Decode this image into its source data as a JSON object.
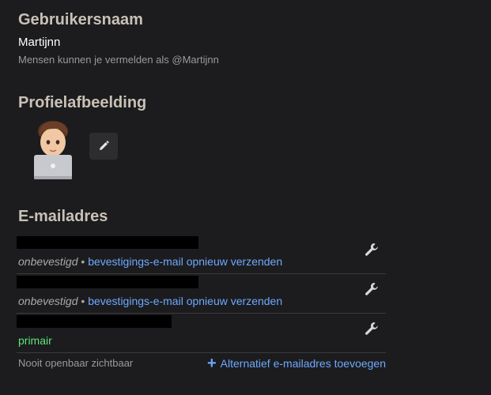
{
  "username_section": {
    "title": "Gebruikersnaam",
    "value": "Martijnn",
    "hint": "Mensen kunnen je vermelden als @Martijnn"
  },
  "avatar_section": {
    "title": "Profielafbeelding",
    "edit_icon": "pencil-icon"
  },
  "email_section": {
    "title": "E-mailadres",
    "rows": [
      {
        "status": "onbevestigd",
        "separator": "•",
        "action": "bevestigings-e-mail opnieuw verzenden"
      },
      {
        "status": "onbevestigd",
        "separator": "•",
        "action": "bevestigings-e-mail opnieuw verzenden"
      },
      {
        "status": "primair"
      }
    ],
    "footer_note": "Nooit openbaar zichtbaar",
    "add_label": "Alternatief e-mailadres toevoegen",
    "add_icon": "plus-icon",
    "row_icon": "wrench-icon"
  },
  "colors": {
    "background": "#1c1c1e",
    "heading": "#c9c1b6",
    "link": "#6ea8ff",
    "primary_badge": "#5ee37a",
    "muted": "#9a9a9a"
  }
}
